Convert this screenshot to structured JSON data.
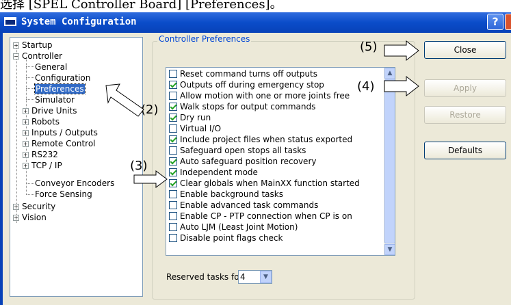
{
  "caption": "选择 [SPEL Controller Board] [Preferences]。",
  "window": {
    "title": "System Configuration",
    "help_label": "?"
  },
  "tree": {
    "startup": "Startup",
    "controller": "Controller",
    "general": "General",
    "configuration": "Configuration",
    "preferences": "Preferences",
    "simulator": "Simulator",
    "drive_units": "Drive Units",
    "robots": "Robots",
    "inputs_outputs": "Inputs / Outputs",
    "remote_control": "Remote Control",
    "rs232": "RS232",
    "tcp_ip": "TCP / IP",
    "conveyor_encoders": "Conveyor Encoders",
    "force_sensing": "Force Sensing",
    "security": "Security",
    "vision": "Vision"
  },
  "group_title": "Controller Preferences",
  "options": [
    {
      "label": "Reset command turns off outputs",
      "checked": false
    },
    {
      "label": "Outputs off during emergency stop",
      "checked": true
    },
    {
      "label": "Allow motion with one or more joints free",
      "checked": false
    },
    {
      "label": "Walk stops for output commands",
      "checked": true
    },
    {
      "label": "Dry run",
      "checked": true
    },
    {
      "label": "Virtual I/O",
      "checked": false
    },
    {
      "label": "Include project files when status exported",
      "checked": true
    },
    {
      "label": "Safeguard open stops all tasks",
      "checked": false
    },
    {
      "label": "Auto safeguard position recovery",
      "checked": true
    },
    {
      "label": "Independent mode",
      "checked": true
    },
    {
      "label": "Clear globals when MainXX function started",
      "checked": true
    },
    {
      "label": "Enable background tasks",
      "checked": false
    },
    {
      "label": "Enable advanced task commands",
      "checked": false
    },
    {
      "label": "Enable CP - PTP connection when CP is on",
      "checked": false
    },
    {
      "label": "Auto LJM (Least Joint Motion)",
      "checked": false
    },
    {
      "label": "Disable point flags check",
      "checked": false
    }
  ],
  "reserved": {
    "label": "Reserved tasks for API",
    "value": "4"
  },
  "buttons": {
    "close": "Close",
    "apply": "Apply",
    "restore": "Restore",
    "defaults": "Defaults"
  },
  "annotations": {
    "a2": "(2)",
    "a3": "(3)",
    "a4": "(4)",
    "a5": "(5)"
  },
  "colors": {
    "titlebar": "#0a4cc9",
    "dialog_bg": "#ece9d8",
    "selection": "#316ac5",
    "check": "#21a121"
  }
}
